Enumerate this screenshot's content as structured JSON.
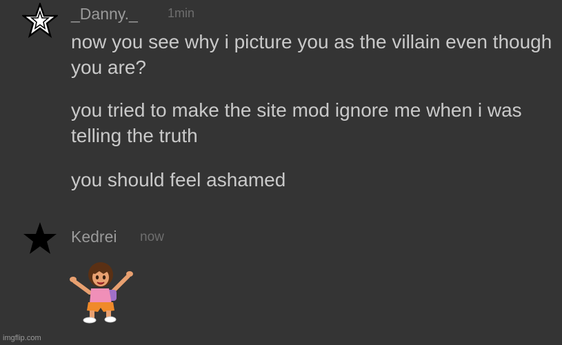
{
  "messages": [
    {
      "username": "_Danny._",
      "time": "1min",
      "avatar_icon": "outline-star-icon",
      "paragraphs": [
        "now you see why i picture you as the villain even though you are?",
        "you tried to make the site mod ignore me when i was telling the truth",
        "you should feel ashamed"
      ]
    },
    {
      "username": "Kedrei",
      "time": "now",
      "avatar_icon": "solid-star-icon",
      "sticker": "dora-sticker"
    }
  ],
  "watermark": "imgflip.com",
  "colors": {
    "background": "#343434",
    "username": "#9a9a9a",
    "timestamp": "#6e6e6e",
    "message_text": "#c9c9c9"
  }
}
